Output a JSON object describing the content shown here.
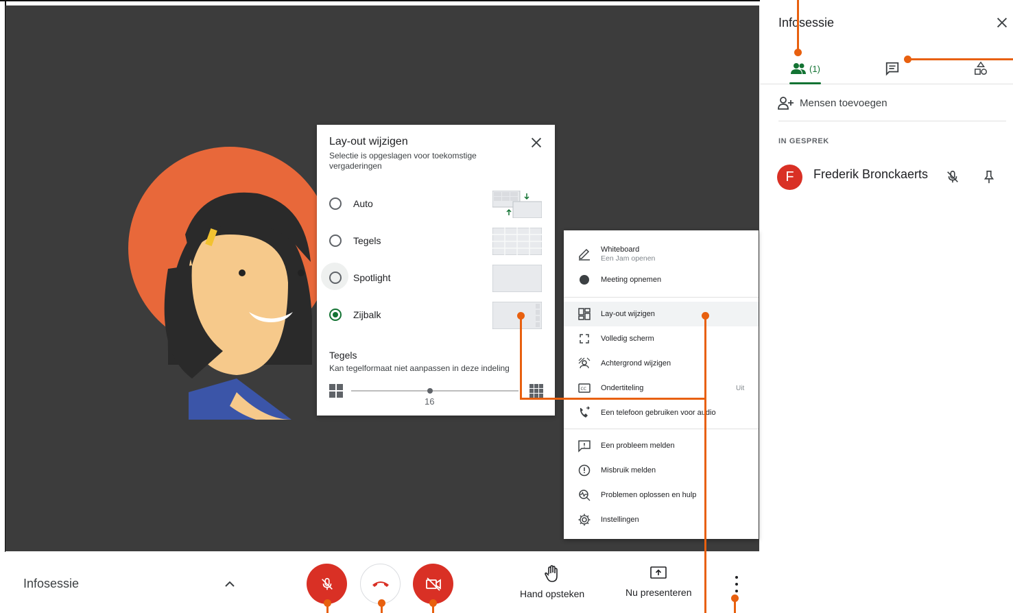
{
  "colors": {
    "accent": "#137333",
    "danger": "#d93025",
    "annotation": "#e8600f",
    "stage_bg": "#3c3c3c"
  },
  "side_panel": {
    "title": "Infosessie",
    "tabs": {
      "people_count": "(1)"
    },
    "add_people": "Mensen toevoegen",
    "section_label": "IN GESPREK",
    "participants": [
      {
        "initial": "F",
        "name": "Frederik Bronckaerts"
      }
    ]
  },
  "layout_dialog": {
    "title": "Lay-out wijzigen",
    "subtitle": "Selectie is opgeslagen voor toekomstige vergaderingen",
    "options": [
      {
        "label": "Auto",
        "selected": false
      },
      {
        "label": "Tegels",
        "selected": false
      },
      {
        "label": "Spotlight",
        "selected": false
      },
      {
        "label": "Zijbalk",
        "selected": true
      }
    ],
    "tiles_title": "Tegels",
    "tiles_subtitle": "Kan tegelformaat niet aanpassen in deze indeling",
    "tiles_value": "16"
  },
  "more_menu": {
    "items": [
      {
        "label": "Whiteboard",
        "sublabel": "Een Jam openen",
        "icon": "pen-icon"
      },
      {
        "label": "Meeting opnemen",
        "icon": "record-icon"
      },
      {
        "label": "Lay-out wijzigen",
        "icon": "layout-icon"
      },
      {
        "label": "Volledig scherm",
        "icon": "fullscreen-icon"
      },
      {
        "label": "Achtergrond wijzigen",
        "icon": "background-icon"
      },
      {
        "label": "Ondertiteling",
        "value": "Uit",
        "icon": "captions-icon"
      },
      {
        "label": "Een telefoon gebruiken voor audio",
        "icon": "phone-icon"
      },
      {
        "label": "Een probleem melden",
        "icon": "feedback-icon"
      },
      {
        "label": "Misbruik melden",
        "icon": "report-icon"
      },
      {
        "label": "Problemen oplossen en hulp",
        "icon": "troubleshoot-icon"
      },
      {
        "label": "Instellingen",
        "icon": "gear-icon"
      }
    ]
  },
  "bottom_bar": {
    "meeting_name": "Infosessie",
    "raise_hand": "Hand opsteken",
    "present": "Nu presenteren"
  }
}
